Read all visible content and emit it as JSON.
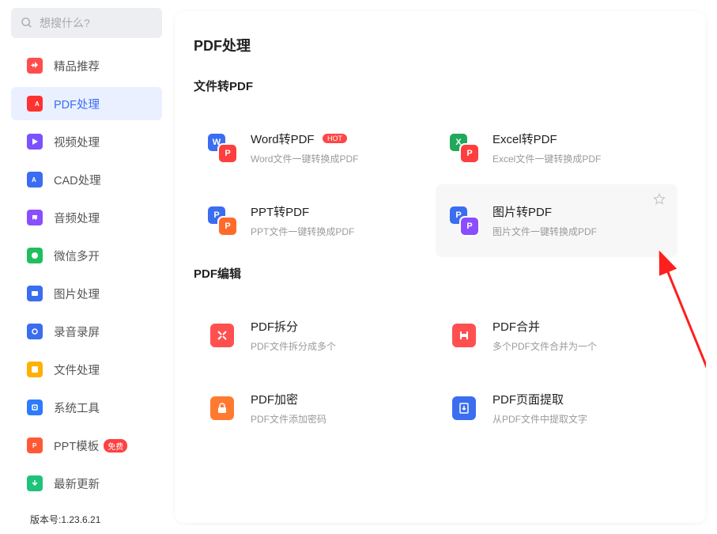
{
  "search": {
    "placeholder": "想搜什么?"
  },
  "sidebar": {
    "items": [
      {
        "label": "精品推荐",
        "color": "#ff4d4d",
        "badge": ""
      },
      {
        "label": "PDF处理",
        "color": "#ff3131",
        "badge": ""
      },
      {
        "label": "视频处理",
        "color": "#7a52ff",
        "badge": ""
      },
      {
        "label": "CAD处理",
        "color": "#3a6df0",
        "badge": ""
      },
      {
        "label": "音频处理",
        "color": "#8a4dff",
        "badge": ""
      },
      {
        "label": "微信多开",
        "color": "#1fbf5e",
        "badge": ""
      },
      {
        "label": "图片处理",
        "color": "#3a6df0",
        "badge": ""
      },
      {
        "label": "录音录屏",
        "color": "#3a6df0",
        "badge": ""
      },
      {
        "label": "文件处理",
        "color": "#ffb000",
        "badge": ""
      },
      {
        "label": "系统工具",
        "color": "#2d7bff",
        "badge": ""
      },
      {
        "label": "PPT模板",
        "color": "#ff5a36",
        "badge": "免费"
      },
      {
        "label": "最新更新",
        "color": "#1fc27a",
        "badge": ""
      }
    ],
    "active_index": 1
  },
  "version": "版本号:1.23.6.21",
  "page": {
    "title": "PDF处理"
  },
  "sections": [
    {
      "title": "文件转PDF",
      "items": [
        {
          "title": "Word转PDF",
          "sub": "Word文件一键转换成PDF",
          "hot": "HOT",
          "back": "#3a6df0",
          "front": "#ff3e3e",
          "backT": "W",
          "frontT": "P"
        },
        {
          "title": "Excel转PDF",
          "sub": "Excel文件一键转换成PDF",
          "hot": "",
          "back": "#20a85b",
          "front": "#ff3e3e",
          "backT": "X",
          "frontT": "P"
        },
        {
          "title": "PPT转PDF",
          "sub": "PPT文件一键转换成PDF",
          "hot": "",
          "back": "#3a6df0",
          "front": "#ff6a2b",
          "backT": "P",
          "frontT": "P"
        },
        {
          "title": "图片转PDF",
          "sub": "图片文件一键转换成PDF",
          "hot": "",
          "back": "#3a6df0",
          "front": "#8a4dff",
          "backT": "P",
          "frontT": "P",
          "hovered": true,
          "star": true
        }
      ]
    },
    {
      "title": "PDF编辑",
      "items": [
        {
          "title": "PDF拆分",
          "sub": "PDF文件拆分成多个",
          "hot": "",
          "single": "#ff5050",
          "glyph": "split"
        },
        {
          "title": "PDF合并",
          "sub": "多个PDF文件合并为一个",
          "hot": "",
          "single": "#ff5050",
          "glyph": "merge"
        },
        {
          "title": "PDF加密",
          "sub": "PDF文件添加密码",
          "hot": "",
          "single": "#ff7a30",
          "glyph": "lock"
        },
        {
          "title": "PDF页面提取",
          "sub": "从PDF文件中提取文字",
          "hot": "",
          "single": "#3a6df0",
          "glyph": "extract"
        }
      ]
    }
  ]
}
